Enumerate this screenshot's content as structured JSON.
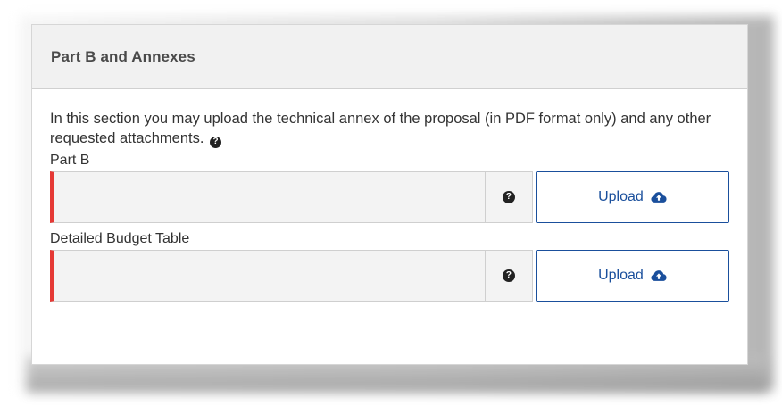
{
  "panel": {
    "title": "Part B and Annexes",
    "intro": "In this section you may upload the technical annex of the proposal (in PDF format only) and any other requested attachments.",
    "help_glyph": "?"
  },
  "fields": [
    {
      "label": "Part B",
      "upload_label": "Upload",
      "help_glyph": "?"
    },
    {
      "label": "Detailed Budget Table",
      "upload_label": "Upload",
      "help_glyph": "?"
    }
  ],
  "icons": {
    "help": "question-circle-icon",
    "upload": "cloud-upload-icon"
  },
  "colors": {
    "accent": "#1a4f9c",
    "required_marker": "#e53935",
    "header_bg": "#f1f1f1",
    "field_bg": "#f3f3f3"
  }
}
